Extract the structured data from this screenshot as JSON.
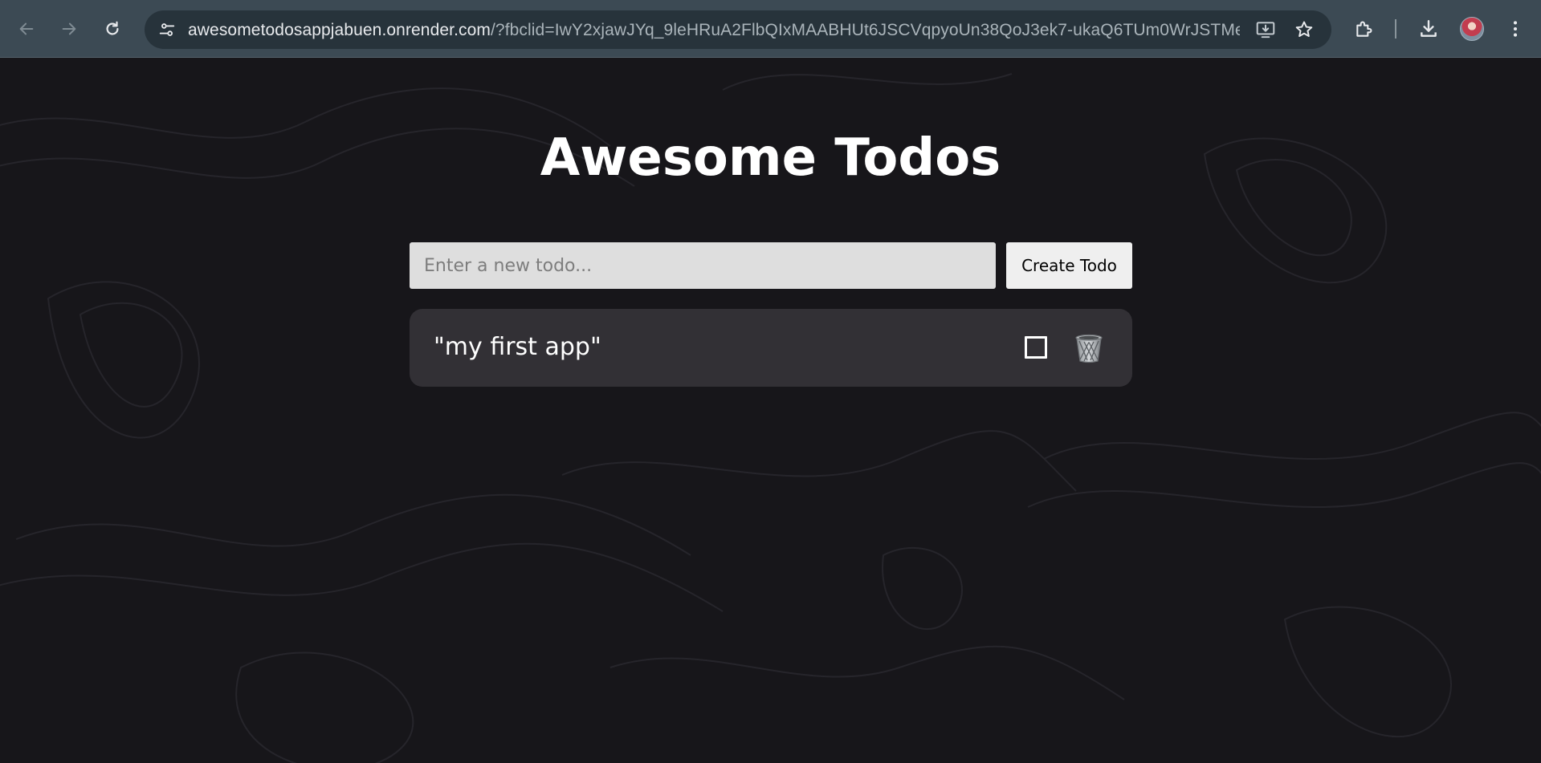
{
  "browser": {
    "url_host": "awesometodosappjabuen.onrender.com",
    "url_rest": "/?fbclid=IwY2xjawJYq_9leHRuA2FlbQIxMAABHUt6JSCVqpyoUn38QoJ3ek7-ukaQ6TUm0WrJSTMe3y...",
    "icons": {
      "back": "arrow-left-icon",
      "forward": "arrow-right-icon",
      "reload": "reload-icon",
      "site_info": "tune-icon",
      "install": "install-app-icon",
      "bookmark": "star-icon",
      "extensions": "puzzle-icon",
      "downloads": "download-icon",
      "menu": "kebab-menu-icon"
    }
  },
  "app": {
    "title": "Awesome Todos",
    "input_placeholder": "Enter a new todo...",
    "input_value": "",
    "create_button_label": "Create Todo",
    "todos": [
      {
        "text": "\"my first app\"",
        "completed": false
      }
    ]
  },
  "colors": {
    "page_background": "#17161a",
    "chrome_background": "#3c4a54",
    "todo_card": "#39383d",
    "input_background": "#dedede",
    "button_background": "#efefef"
  }
}
